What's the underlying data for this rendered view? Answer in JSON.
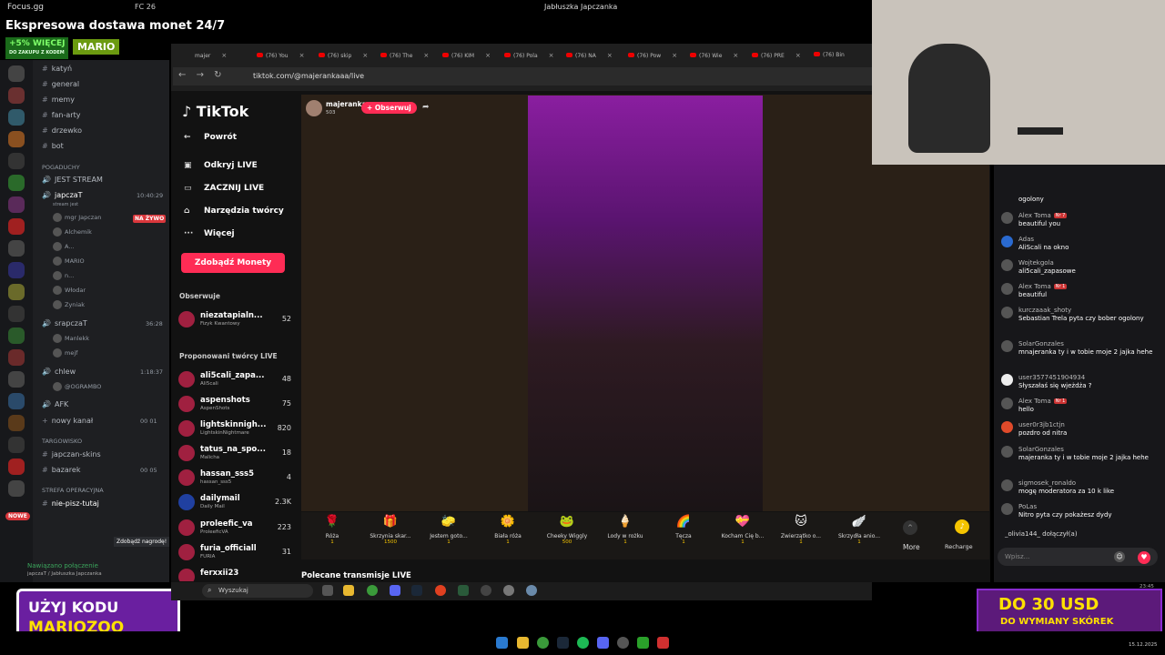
{
  "top": {
    "site": "Focus.gg",
    "game_status": "FC 26",
    "window_title": "Jabłuszka Japczanka"
  },
  "promo": {
    "headline": "Ekspresowa dostawa monet 24/7",
    "bonus": "+5% WIĘCEJ",
    "bonus_sub": "DO ZAKUPU Z KODEM",
    "code": "MARIO"
  },
  "discord": {
    "channels": [
      "katyń",
      "general",
      "memy",
      "fan-arty",
      "drzewko",
      "bot"
    ],
    "category_pogaduchy": "POGADUCHY",
    "voice": [
      "JEST STREAM",
      "japczaT",
      "srapczaT",
      "chlew",
      "AFK",
      "nowy kanał"
    ],
    "voice_sub": "stream jest",
    "live_badge": "NA ŻYWO",
    "japcza_time": "10:40:29",
    "srapcza_time": "36:28",
    "chlew_time": "1:18:37",
    "users_japcza": [
      "mgr Japczan",
      "Alchemik",
      "A...",
      "MARIO",
      "n...",
      "Włodar",
      "Zyniak"
    ],
    "users_srapcza": [
      "Manlekk",
      "mejf"
    ],
    "users_chlew": [
      "@OGRAMBO"
    ],
    "nowy_counts": "00 01",
    "category_targowisko": "TARGOWISKO",
    "targ": [
      "japczan-skins",
      "bazarek"
    ],
    "bazarek_counts": "00 05",
    "category_strefa": "STREFA OPERACYJNA",
    "strefa": [
      "nie-pisz-tutaj"
    ],
    "nowe": "NOWE",
    "reward_btn": "Zdobądź nagrodę!",
    "voice_connected": "Nawiązano połączenie",
    "voice_connected_sub": "japczaT / Jabłuszka Japczanka"
  },
  "code_ad": {
    "line1": "UŻYJ KODU",
    "line2": "MARIOZOO"
  },
  "browser": {
    "tabs": [
      "majer",
      "(76) You",
      "(76) skip",
      "(76) The",
      "(76) KIM",
      "(76) Pola",
      "(76) NA",
      "(76) Pow",
      "(76) Wie",
      "(76) PRE",
      "(76) Bin"
    ],
    "url": "tiktok.com/@majerankaaa/live"
  },
  "tiktok": {
    "logo": "TikTok",
    "nav": [
      "Powrót",
      "Odkryj LIVE",
      "ZACZNIJ LIVE",
      "Narzędzia twórcy",
      "Więcej"
    ],
    "monety": "Zdobądź Monety",
    "obserwuje": "Obserwuje",
    "followed": {
      "name": "niezatapialn...",
      "sub": "Fizyk Kwantowy",
      "count": "52"
    },
    "proponowani": "Proponowani twórcy LIVE",
    "creators": [
      {
        "name": "ali5cali_zapa...",
        "sub": "Ali5cali",
        "count": "48"
      },
      {
        "name": "aspenshots",
        "sub": "AspenShots",
        "count": "75"
      },
      {
        "name": "lightskinnigh...",
        "sub": "LightskinNightmare",
        "count": "820"
      },
      {
        "name": "tatus_na_spo...",
        "sub": "Malicha",
        "count": "18"
      },
      {
        "name": "hassan_sss5",
        "sub": "hassan_sss5",
        "count": "4"
      },
      {
        "name": "dailymail",
        "sub": "Daily Mail",
        "count": "2.3K"
      },
      {
        "name": "proleefic_va",
        "sub": "ProleeficVA",
        "count": "223"
      },
      {
        "name": "furia_officiall",
        "sub": "FURIA",
        "count": "31"
      },
      {
        "name": "ferxxii23",
        "sub": "",
        "count": ""
      }
    ],
    "streamer": "majeranka",
    "viewers": "503",
    "follow_btn": "+ Obserwuj",
    "gifts": [
      {
        "name": "Róża",
        "price": "1",
        "icon": "🌹"
      },
      {
        "name": "Skrzynia skar...",
        "price": "1500",
        "icon": "🎁"
      },
      {
        "name": "Jestem goto...",
        "price": "1",
        "icon": "🧽"
      },
      {
        "name": "Biała róża",
        "price": "1",
        "icon": "🌼"
      },
      {
        "name": "Cheeky Wiggly",
        "price": "500",
        "icon": "🐸"
      },
      {
        "name": "Lody w rożku",
        "price": "1",
        "icon": "🍦"
      },
      {
        "name": "Tęcza",
        "price": "1",
        "icon": "🌈"
      },
      {
        "name": "Kocham Cię b...",
        "price": "1",
        "icon": "💝"
      },
      {
        "name": "Zwierzątko o...",
        "price": "1",
        "icon": "🐱"
      },
      {
        "name": "Skrzydła anio...",
        "price": "1",
        "icon": "🪽"
      }
    ],
    "more": "More",
    "recharge": "Recharge",
    "polecane": "Polecane transmisje LIVE"
  },
  "chat": {
    "messages": [
      {
        "user": "Alex Toma",
        "badge": "Nr 7",
        "text": "beautiful you"
      },
      {
        "user": "Adas",
        "badge": "",
        "text": "AliScali na okno"
      },
      {
        "user": "Wojtekgola",
        "badge": "",
        "text": "ali5cali_zapasowe"
      },
      {
        "user": "Alex Toma",
        "badge": "Nr 1",
        "text": "beautiful"
      },
      {
        "user": "kurczaaak_shoty",
        "badge": "",
        "text": "Sebastian Trela pyta czy bober ogolony"
      },
      {
        "user": "SolarGonzales",
        "badge": "",
        "text": "mnajeranka ty i w tobie moje 2 jajka hehe"
      },
      {
        "user": "user3577451904934",
        "badge": "",
        "text": "Słyszałaś się wjeżdża ?"
      },
      {
        "user": "Alex Toma",
        "badge": "Nr 1",
        "text": "hello"
      },
      {
        "user": "user0r3jb1ctjn",
        "badge": "",
        "text": "pozdro od nitra"
      },
      {
        "user": "SolarGonzales",
        "badge": "",
        "text": "majeranka ty i w tobie moje 2 jajka hehe"
      },
      {
        "user": "sigmosek_ronaldo",
        "badge": "",
        "text": "mogę moderatora za 10 k like"
      },
      {
        "user": "PoLas",
        "badge": "",
        "text": "Nitro pyta czy pokażesz dydy"
      }
    ],
    "top_partial": "ogolony",
    "joined": "_olivia144_ dołączył(a)",
    "input_placeholder": "Wpisz..."
  },
  "taskbar": {
    "search": "Wyszukaj",
    "time": "23:45",
    "date": "15.12.2025"
  },
  "pirate": {
    "line1": "DO 30 USD",
    "line2": "DO WYMIANY SKÓREK",
    "src": "PIRATESWAP.COM"
  }
}
